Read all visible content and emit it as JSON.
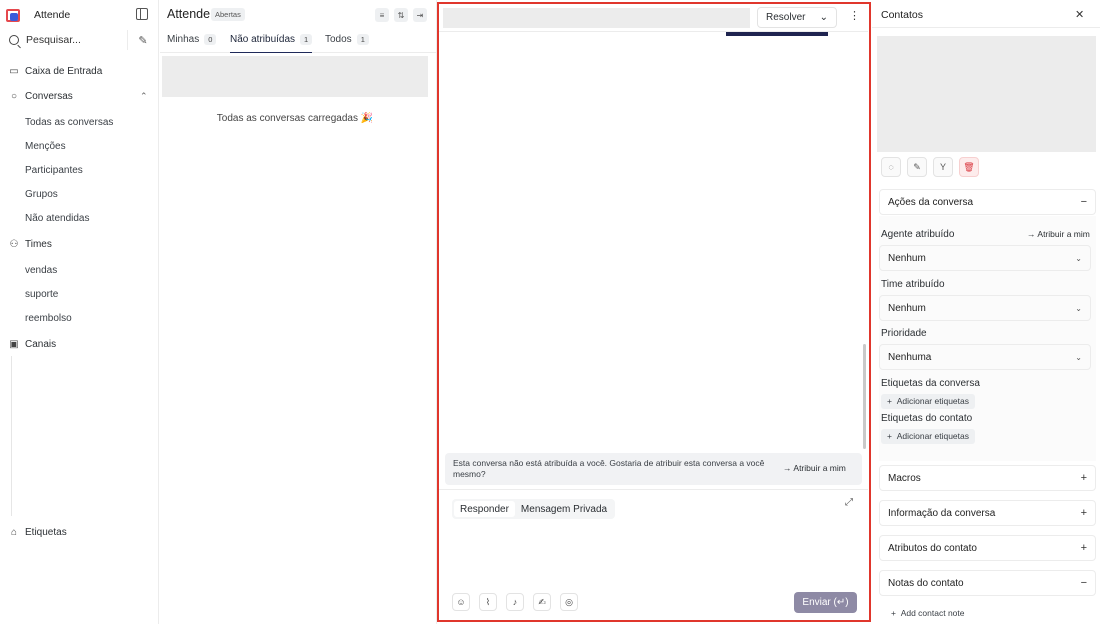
{
  "sidebar": {
    "brand": "Attende",
    "search_label": "Pesquisar...",
    "items": {
      "inbox": "Caixa de Entrada",
      "conversations": "Conversas",
      "all_conversations": "Todas as conversas",
      "mentions": "Menções",
      "participants": "Participantes",
      "groups": "Grupos",
      "unattended": "Não atendidas",
      "teams": "Times",
      "team_sales": "vendas",
      "team_support": "suporte",
      "team_refund": "reembolso",
      "channels": "Canais",
      "labels": "Etiquetas"
    }
  },
  "convlist": {
    "title": "Attende",
    "status_badge": "Abertas",
    "tabs": [
      {
        "label": "Minhas",
        "count": "0"
      },
      {
        "label": "Não atribuídas",
        "count": "1"
      },
      {
        "label": "Todos",
        "count": "1"
      }
    ],
    "loaded_message": "Todas as conversas carregadas 🎉"
  },
  "main": {
    "resolve_label": "Resolver",
    "assign_notice": "Esta conversa não está atribuída a você. Gostaria de atribuir esta conversa a você mesmo?",
    "assign_action": "Atribuir a mim",
    "reply_tabs": [
      "Responder",
      "Mensagem Privada"
    ],
    "send_label": "Enviar (↵)"
  },
  "contact": {
    "title": "Contatos",
    "conversation_actions": "Ações da conversa",
    "assigned_agent_label": "Agente atribuído",
    "assign_to_me": "Atribuir a mim",
    "assigned_agent_value": "Nenhum",
    "assigned_team_label": "Time atribuído",
    "assigned_team_value": "Nenhum",
    "priority_label": "Prioridade",
    "priority_value": "Nenhuma",
    "conversation_labels": "Etiquetas da conversa",
    "add_labels": "Adicionar etiquetas",
    "contact_labels": "Etiquetas do contato",
    "macros": "Macros",
    "conversation_info": "Informação da conversa",
    "contact_attributes": "Atributos do contato",
    "contact_notes": "Notas do contato",
    "add_note": "Add contact note"
  }
}
